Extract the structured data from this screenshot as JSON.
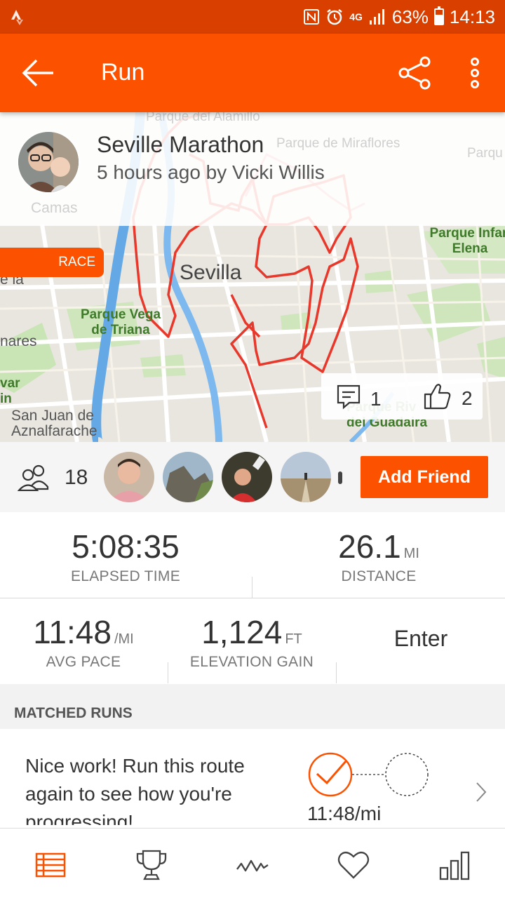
{
  "status_bar": {
    "battery": "63%",
    "time": "14:13",
    "network": "4G"
  },
  "appbar": {
    "title": "Run",
    "icons": [
      "back-arrow-icon",
      "share-icon",
      "more-vert-icon"
    ]
  },
  "activity": {
    "title": "Seville Marathon",
    "subtitle": "5 hours ago by Vicki Willis",
    "badge": "RACE",
    "comments": "1",
    "kudos": "2"
  },
  "map": {
    "labels": {
      "parque_alamillo": "Parque del Alamillo",
      "parque_miraflores": "Parque de Miraflores",
      "parque_right": "Parqu",
      "camas": "Camas",
      "parque_infanta": "Parque Infan\nElena",
      "ia": "e la",
      "sevilla": "Sevilla",
      "parque_vega": "Parque Vega\nde Triana",
      "nares": "nares",
      "var": "var\nin",
      "san_juan": "San Juan de\nAznalfarache",
      "parque_rio": "Parque Riv\ndel Guadaira"
    }
  },
  "athletes": {
    "count": "18",
    "add_friend_label": "Add Friend"
  },
  "stats": {
    "elapsed_time": {
      "value": "5:08:35",
      "label": "ELAPSED TIME"
    },
    "distance": {
      "value": "26.1",
      "unit": "MI",
      "label": "DISTANCE"
    },
    "avg_pace": {
      "value": "11:48",
      "unit": "/MI",
      "label": "AVG PACE"
    },
    "elevation_gain": {
      "value": "1,124",
      "unit": "FT",
      "label": "ELEVATION GAIN"
    },
    "enter_label": "Enter"
  },
  "matched_runs": {
    "header": "MATCHED RUNS",
    "message": "Nice work! Run this route again to see how you're progressing!",
    "pace": "11:48/mi"
  },
  "bottom_nav": {
    "items": [
      "feed-icon",
      "trophy-icon",
      "activity-pulse-icon",
      "heart-icon",
      "stats-bars-icon"
    ],
    "active_color": "#fc5200"
  },
  "colors": {
    "brand": "#fc5200",
    "status_bar": "#d94000",
    "route": "#e8382b"
  }
}
